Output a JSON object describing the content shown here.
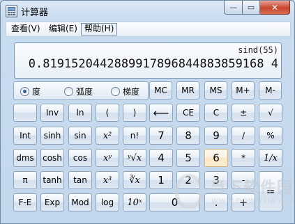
{
  "window": {
    "title": "计算器"
  },
  "caption": {
    "minimize": "—",
    "maximize": "▭",
    "close": "✕"
  },
  "menu": [
    {
      "label": "查看(V)"
    },
    {
      "label": "编辑(E)"
    },
    {
      "label": "帮助(H)"
    }
  ],
  "display": {
    "expression": "sind(55)",
    "result": "0.8191520442889917896844883859168 4"
  },
  "angle_modes": [
    {
      "label": "度",
      "selected": true
    },
    {
      "label": "弧度",
      "selected": false
    },
    {
      "label": "梯度",
      "selected": false
    }
  ],
  "buttons": {
    "mc": "MC",
    "mr": "MR",
    "ms": "MS",
    "mplus": "M+",
    "mminus": "M-",
    "inv": "Inv",
    "ln": "ln",
    "lparen": "(",
    "rparen": ")",
    "backspace": "⟵",
    "ce": "CE",
    "c": "C",
    "plusminus": "±",
    "sqrt": "√",
    "int": "Int",
    "sinh": "sinh",
    "sin": "sin",
    "x2": "x²",
    "nfact": "n!",
    "n7": "7",
    "n8": "8",
    "n9": "9",
    "div": "/",
    "pct": "%",
    "dms": "dms",
    "cosh": "cosh",
    "cos": "cos",
    "xy": "xʸ",
    "yroot": "ʸ√x",
    "n4": "4",
    "n5": "5",
    "n6": "6",
    "mul": "*",
    "recip": "1/x",
    "pi": "π",
    "tanh": "tanh",
    "tan": "tan",
    "x3": "x³",
    "root3": "∛x",
    "n1": "1",
    "n2": "2",
    "n3": "3",
    "minus": "-",
    "equals": "=",
    "fe": "F-E",
    "exp": "Exp",
    "mod": "Mod",
    "log": "log",
    "tenx": "10ˣ",
    "n0": "0",
    "dot": ".",
    "plus": "+"
  },
  "watermark": {
    "title": "当下软件园",
    "url": "WWW.DOWNXIA.COM"
  },
  "colors": {
    "accent": "#c7452d",
    "window_bg": "#c9dcf0",
    "hover": "#fae6c1"
  }
}
